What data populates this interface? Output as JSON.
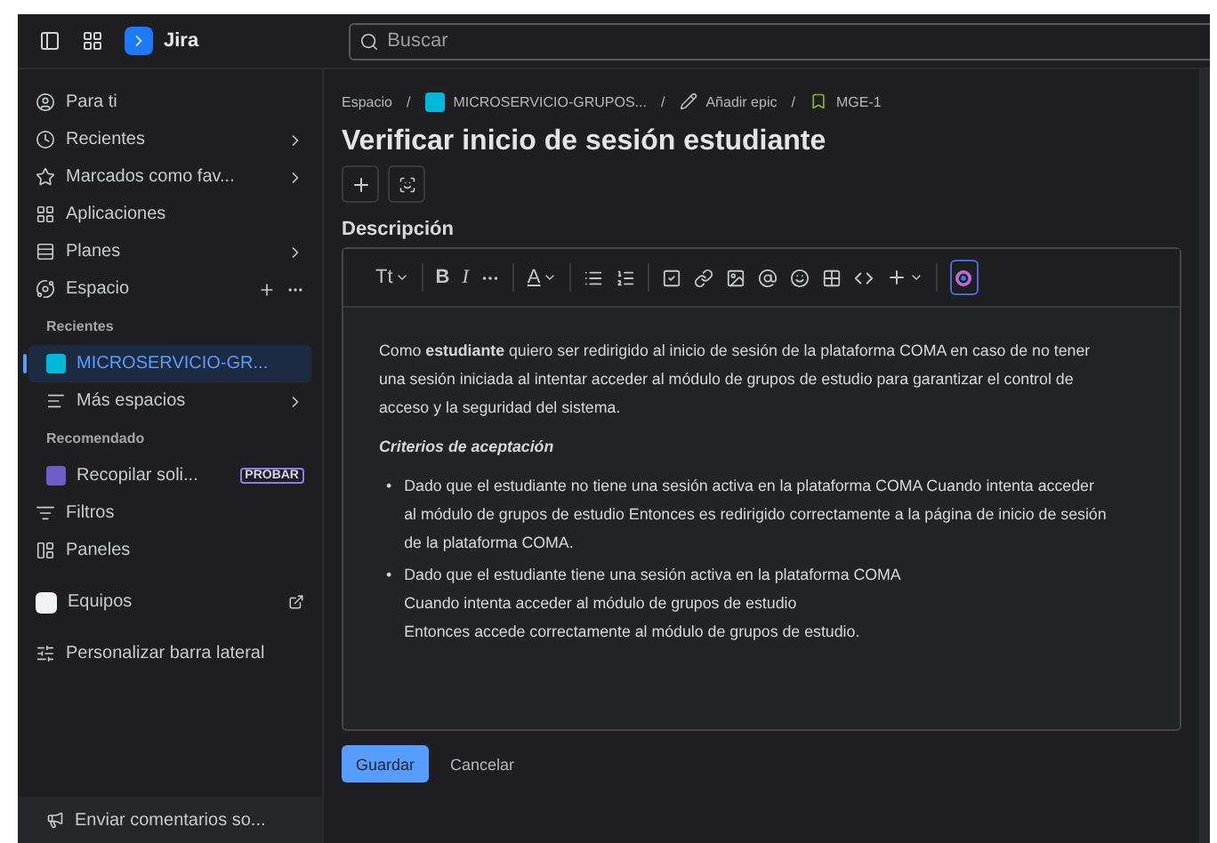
{
  "topbar": {
    "app_name": "Jira",
    "search": {
      "placeholder": "Buscar"
    }
  },
  "sidebar": {
    "items": [
      {
        "kind": "nav",
        "label": "Para ti",
        "chevron": false,
        "selected": false
      },
      {
        "kind": "nav",
        "label": "Recientes",
        "chevron": true,
        "selected": false
      },
      {
        "kind": "nav",
        "label": "Marcados como fav...",
        "chevron": true,
        "selected": false
      },
      {
        "kind": "nav",
        "label": "Aplicaciones",
        "chevron": false,
        "selected": false
      },
      {
        "kind": "nav",
        "label": "Planes",
        "chevron": true,
        "selected": false
      },
      {
        "kind": "space",
        "label": "Espacio",
        "selected": false
      },
      {
        "kind": "heading",
        "label": "Recientes"
      },
      {
        "kind": "project",
        "label": "MICROSERVICIO-GR...",
        "chevron": false,
        "selected": true
      },
      {
        "kind": "sub",
        "label": "Más espacios",
        "chevron": true,
        "selected": false
      },
      {
        "kind": "heading",
        "label": "Recomendado"
      },
      {
        "kind": "promo",
        "label": "Recopilar soli...",
        "badge": "PROBAR",
        "selected": false
      },
      {
        "kind": "nav",
        "label": "Filtros",
        "chevron": false,
        "selected": false
      },
      {
        "kind": "nav",
        "label": "Paneles",
        "chevron": false,
        "selected": false
      },
      {
        "kind": "external",
        "label": "Equipos",
        "selected": false
      },
      {
        "kind": "nav",
        "label": "Personalizar barra lateral",
        "chevron": false,
        "selected": false
      }
    ],
    "footer": "Enviar comentarios so..."
  },
  "breadcrumb": {
    "separator": "/",
    "items": [
      "Espacio",
      "MICROSERVICIO-GRUPOS...",
      "Añadir epic",
      "MGE-1"
    ]
  },
  "title": "Verificar inicio de sesión estudiante",
  "description": {
    "label": "Descripción",
    "toolbar": {
      "text_style": "Tt",
      "bold": "B",
      "italic": "I",
      "text_color_letter": "A"
    },
    "paragraph": "Como **estudiante** quiero ser redirigido al inicio de sesión de la plataforma COMA en caso de no tener una sesión iniciada al intentar acceder al módulo de grupos de estudio para garantizar el control de acceso y la seguridad del sistema.",
    "heading": "Criterios de aceptación",
    "bullets": [
      {
        "marker": "•",
        "lines": [
          "Dado que el estudiante no tiene una sesión activa en la plataforma COMA Cuando intenta acceder al módulo de grupos de estudio Entonces es redirigido correctamente a la página de inicio de sesión de la plataforma COMA."
        ]
      },
      {
        "marker": "•",
        "lines": [
          "Dado que el estudiante tiene una sesión activa en la plataforma COMA",
          "Cuando intenta acceder al módulo de grupos de estudio",
          "Entonces accede correctamente al módulo de grupos de estudio."
        ]
      }
    ]
  },
  "buttons": {
    "save": "Guardar",
    "cancel": "Cancelar"
  }
}
